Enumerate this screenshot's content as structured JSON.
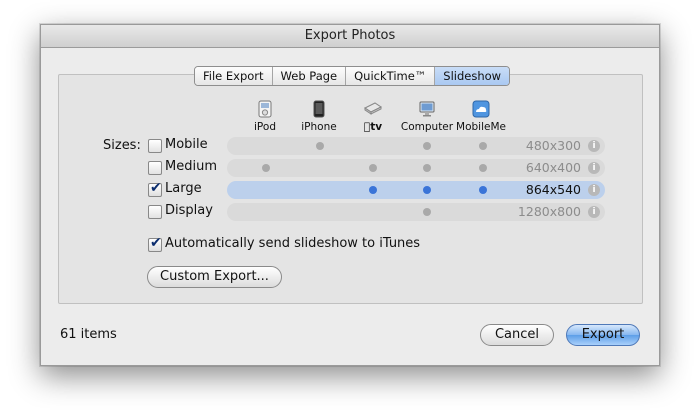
{
  "window": {
    "title": "Export Photos"
  },
  "tabs": [
    {
      "label": "File Export",
      "active": false
    },
    {
      "label": "Web Page",
      "active": false
    },
    {
      "label": "QuickTime™",
      "active": false
    },
    {
      "label": "Slideshow",
      "active": true
    }
  ],
  "devices": [
    {
      "label": "iPod",
      "icon": "ipod-icon"
    },
    {
      "label": "iPhone",
      "icon": "iphone-icon"
    },
    {
      "label": "tv",
      "icon": "apple-tv-icon"
    },
    {
      "label": "Computer",
      "icon": "computer-icon"
    },
    {
      "label": "MobileMe",
      "icon": "mobileme-icon"
    }
  ],
  "sizes": {
    "label": "Sizes:",
    "rows": [
      {
        "name": "Mobile",
        "checked": false,
        "dims": "480x300",
        "devices": [
          "iPhone",
          "Computer",
          "MobileMe"
        ]
      },
      {
        "name": "Medium",
        "checked": false,
        "dims": "640x400",
        "devices": [
          "iPod",
          "tv",
          "Computer",
          "MobileMe"
        ]
      },
      {
        "name": "Large",
        "checked": true,
        "dims": "864x540",
        "devices": [
          "tv",
          "Computer",
          "MobileMe"
        ]
      },
      {
        "name": "Display",
        "checked": false,
        "dims": "1280x800",
        "devices": [
          "Computer"
        ]
      }
    ]
  },
  "auto_send": {
    "label": "Automatically send slideshow to iTunes",
    "checked": true
  },
  "custom_export": {
    "label": "Custom Export..."
  },
  "footer": {
    "items_count": "61 items",
    "cancel_label": "Cancel",
    "export_label": "Export"
  },
  "colors": {
    "accent": "#3a74d8",
    "selected_row": "#bcd0ec",
    "default_button": "#86b7f0"
  }
}
